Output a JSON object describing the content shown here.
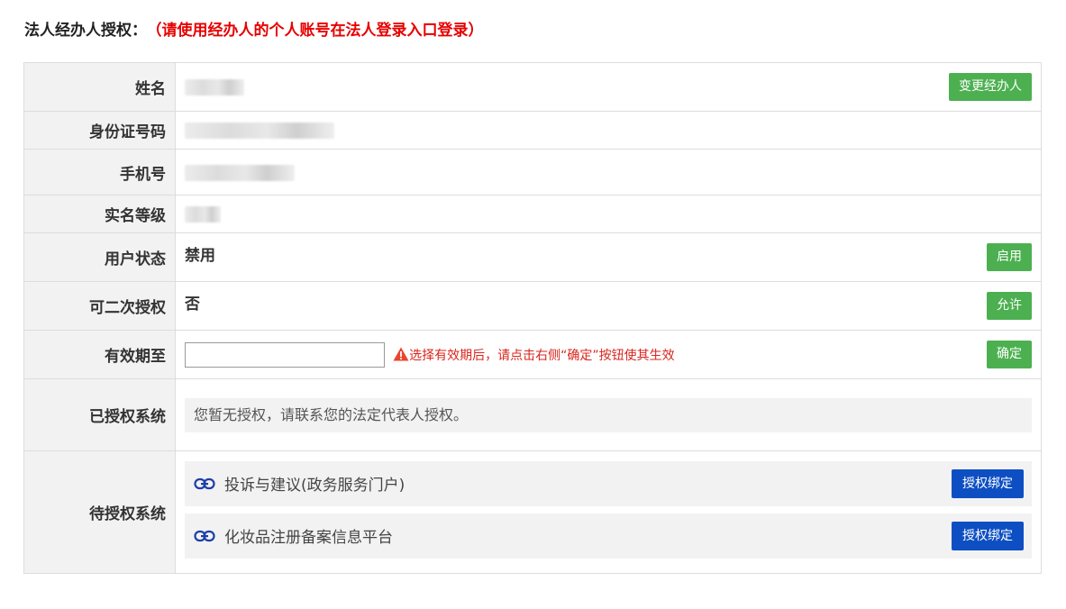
{
  "heading": {
    "title": "法人经办人授权：",
    "note": "（请使用经办人的个人账号在法人登录入口登录）"
  },
  "rows": {
    "name": {
      "label": "姓名",
      "button": "变更经办人"
    },
    "id_number": {
      "label": "身份证号码"
    },
    "phone": {
      "label": "手机号"
    },
    "auth_level": {
      "label": "实名等级"
    },
    "user_status": {
      "label": "用户状态",
      "value": "禁用",
      "button": "启用"
    },
    "reauthorize": {
      "label": "可二次授权",
      "value": "否",
      "button": "允许"
    },
    "valid_until": {
      "label": "有效期至",
      "input_value": "",
      "warning": "选择有效期后，请点击右侧“确定”按钮使其生效",
      "button": "确定"
    },
    "authorized_systems": {
      "label": "已授权系统",
      "empty_text": "您暂无授权，请联系您的法定代表人授权。"
    },
    "pending_systems": {
      "label": "待授权系统",
      "items": [
        {
          "name": "投诉与建议(政务服务门户)",
          "button": "授权绑定"
        },
        {
          "name": "化妆品注册备案信息平台",
          "button": "授权绑定"
        }
      ]
    }
  },
  "colors": {
    "accent_green": "#4cb050",
    "accent_blue": "#0d4fc3",
    "warning_red": "#d9251d",
    "note_red": "#e60000"
  },
  "icons": {
    "warning": "warning-triangle-icon",
    "link": "link-icon"
  }
}
